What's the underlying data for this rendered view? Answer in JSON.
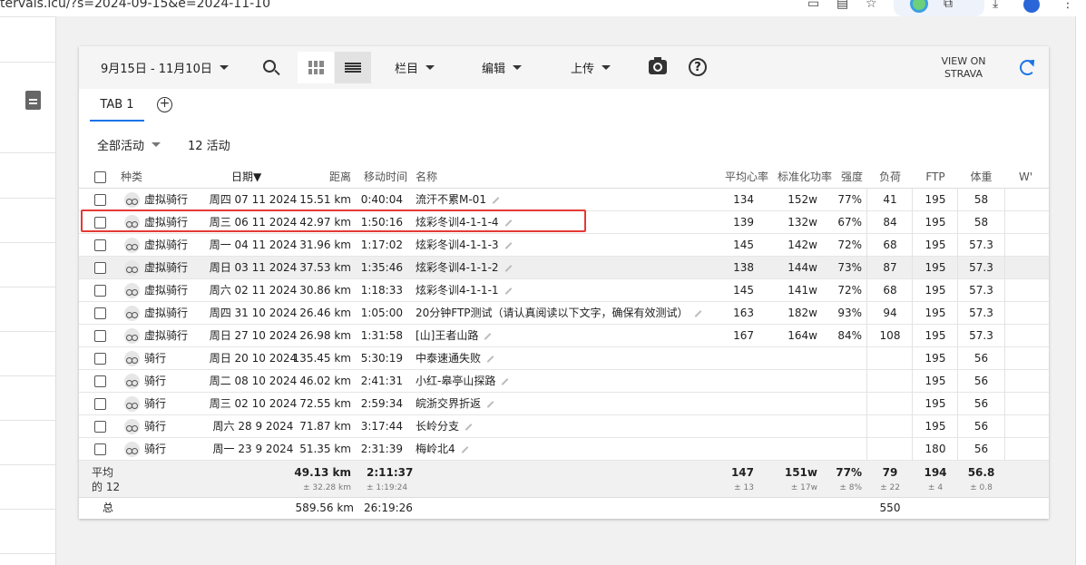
{
  "browser": {
    "url": "tervals.icu/?s=2024-09-15&e=2024-11-10"
  },
  "toolbar": {
    "date_range": "9月15日 - 11月10日",
    "columns_label": "栏目",
    "edit_label": "编辑",
    "upload_label": "上传",
    "help_label": "?",
    "strava_line1": "VIEW ON",
    "strava_line2": "STRAVA"
  },
  "tabs": {
    "tab1_label": "TAB 1",
    "add_label": "+"
  },
  "filter": {
    "activity_filter": "全部活动",
    "count": "12 活动"
  },
  "table": {
    "headers": {
      "type": "种类",
      "date": "日期▼",
      "distance": "距离",
      "moving_time": "移动时间",
      "name": "名称",
      "avg_hr": "平均心率",
      "np": "标准化功率",
      "intensity": "强度",
      "load": "负荷",
      "ftp": "FTP",
      "weight": "体重",
      "wprime": "W'"
    },
    "rows": [
      {
        "type": "虚拟骑行",
        "date": "周四 07 11 2024",
        "distance": "15.51 km",
        "time": "0:40:04",
        "name": "流汗不累M-01",
        "hr": "134",
        "np": "152w",
        "intensity": "77%",
        "load": "41",
        "ftp": "195",
        "weight": "58"
      },
      {
        "type": "虚拟骑行",
        "date": "周三 06 11 2024",
        "distance": "42.97 km",
        "time": "1:50:16",
        "name": "炫彩冬训4-1-1-4",
        "hr": "139",
        "np": "132w",
        "intensity": "67%",
        "load": "84",
        "ftp": "195",
        "weight": "58"
      },
      {
        "type": "虚拟骑行",
        "date": "周一 04 11 2024",
        "distance": "31.96 km",
        "time": "1:17:02",
        "name": "炫彩冬训4-1-1-3",
        "hr": "145",
        "np": "142w",
        "intensity": "72%",
        "load": "68",
        "ftp": "195",
        "weight": "57.3"
      },
      {
        "type": "虚拟骑行",
        "date": "周日 03 11 2024",
        "distance": "37.53 km",
        "time": "1:35:46",
        "name": "炫彩冬训4-1-1-2",
        "hr": "138",
        "np": "144w",
        "intensity": "73%",
        "load": "87",
        "ftp": "195",
        "weight": "57.3"
      },
      {
        "type": "虚拟骑行",
        "date": "周六 02 11 2024",
        "distance": "30.86 km",
        "time": "1:18:33",
        "name": "炫彩冬训4-1-1-1",
        "hr": "145",
        "np": "141w",
        "intensity": "72%",
        "load": "68",
        "ftp": "195",
        "weight": "57.3"
      },
      {
        "type": "虚拟骑行",
        "date": "周四 31 10 2024",
        "distance": "26.46 km",
        "time": "1:05:00",
        "name": "20分钟FTP测试（请认真阅读以下文字，确保有效测试）",
        "hr": "163",
        "np": "182w",
        "intensity": "93%",
        "load": "94",
        "ftp": "195",
        "weight": "57.3"
      },
      {
        "type": "虚拟骑行",
        "date": "周日 27 10 2024",
        "distance": "26.98 km",
        "time": "1:31:58",
        "name": "[山]王者山路",
        "hr": "167",
        "np": "164w",
        "intensity": "84%",
        "load": "108",
        "ftp": "195",
        "weight": "57.3"
      },
      {
        "type": "骑行",
        "date": "周日 20 10 2024",
        "distance": "135.45 km",
        "time": "5:30:19",
        "name": "中泰速通失败",
        "hr": "",
        "np": "",
        "intensity": "",
        "load": "",
        "ftp": "195",
        "weight": "56"
      },
      {
        "type": "骑行",
        "date": "周二 08 10 2024",
        "distance": "46.02 km",
        "time": "2:41:31",
        "name": "小红-皋亭山探路",
        "hr": "",
        "np": "",
        "intensity": "",
        "load": "",
        "ftp": "195",
        "weight": "56"
      },
      {
        "type": "骑行",
        "date": "周三 02 10 2024",
        "distance": "72.55 km",
        "time": "2:59:34",
        "name": "皖浙交界折返",
        "hr": "",
        "np": "",
        "intensity": "",
        "load": "",
        "ftp": "195",
        "weight": "56"
      },
      {
        "type": "骑行",
        "date": "周六 28 9 2024",
        "distance": "71.87 km",
        "time": "3:17:44",
        "name": "长岭分支",
        "hr": "",
        "np": "",
        "intensity": "",
        "load": "",
        "ftp": "195",
        "weight": "56"
      },
      {
        "type": "骑行",
        "date": "周一 23 9 2024",
        "distance": "51.35 km",
        "time": "2:31:39",
        "name": "梅岭北4",
        "hr": "",
        "np": "",
        "intensity": "",
        "load": "",
        "ftp": "180",
        "weight": "56"
      }
    ],
    "average": {
      "label_line1": "平均",
      "label_line2": "的 12",
      "distance": "49.13 km",
      "distance_sd": "± 32.28 km",
      "time": "2:11:37",
      "time_sd": "± 1:19:24",
      "hr": "147",
      "hr_sd": "± 13",
      "np": "151w",
      "np_sd": "± 17w",
      "intensity": "77%",
      "intensity_sd": "± 8%",
      "load": "79",
      "load_sd": "± 22",
      "ftp": "194",
      "ftp_sd": "± 4",
      "weight": "56.8",
      "weight_sd": "± 0.8"
    },
    "total": {
      "label": "总",
      "distance": "589.56 km",
      "time": "26:19:26",
      "load": "550"
    }
  },
  "colors": {
    "accent": "#1a73e8",
    "highlight_box": "#e53935"
  }
}
